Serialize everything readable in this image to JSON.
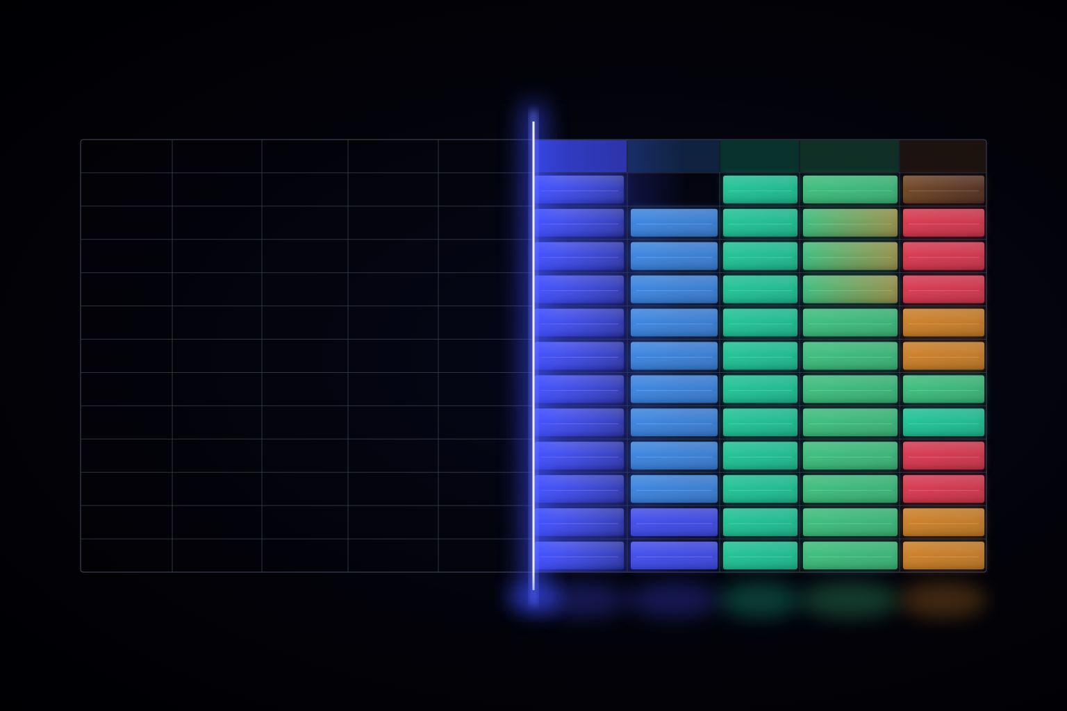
{
  "grid": {
    "rows": 13,
    "header_row_count": 1,
    "dark_columns": 5,
    "colored_columns": 5
  },
  "palette": {
    "background": "#020208",
    "grid_line": "#3a3f52",
    "scanline": "#eef0ff",
    "scanline_glow": "#3b4dff",
    "indigo": "#4350ff",
    "blue": "#3d8ef0",
    "teal": "#1ed6a0",
    "green": "#3fcf86",
    "red": "#ee3a52",
    "orange": "#e08a26"
  },
  "cells": {
    "column_1": [
      "indigo",
      "indigo",
      "indigo",
      "indigo",
      "indigo",
      "indigo",
      "indigo",
      "indigo",
      "indigo",
      "indigo",
      "indigo",
      "indigo"
    ],
    "column_2": [
      "none",
      "blue",
      "blue",
      "blue",
      "blue",
      "blue",
      "blue",
      "blue",
      "blue",
      "blue",
      "indigo",
      "indigo"
    ],
    "column_3": [
      "teal",
      "teal",
      "teal",
      "teal",
      "teal",
      "teal",
      "teal",
      "teal",
      "teal",
      "teal",
      "teal",
      "teal"
    ],
    "column_4": [
      "green",
      "green-amber",
      "green-amber",
      "green-amber",
      "green",
      "green",
      "green",
      "green",
      "green",
      "green",
      "green",
      "green"
    ],
    "column_5": [
      "amber-dim",
      "red",
      "red",
      "red",
      "orange",
      "orange",
      "green",
      "teal",
      "red",
      "red",
      "orange",
      "orange"
    ]
  }
}
